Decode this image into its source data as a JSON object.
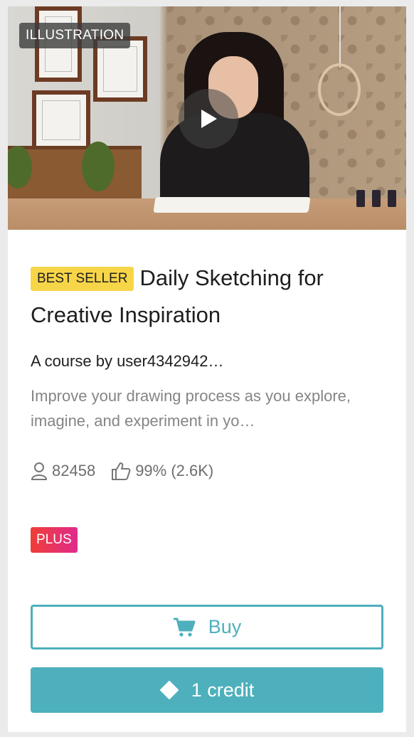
{
  "course": {
    "category_tag": "ILLUSTRATION",
    "badge": "BEST SELLER",
    "title": "Daily Sketching for Creative Inspiration",
    "author": "A course by user4342942…",
    "description": "Improve your drawing process as you explore, imagine, and experiment in yo…",
    "students": "82458",
    "rating": "99% (2.6K)",
    "plan_badge": "PLUS"
  },
  "actions": {
    "buy_label": "Buy",
    "credit_label": "1 credit"
  },
  "colors": {
    "accent": "#4eb0bc",
    "best_seller_bg": "#f7d548",
    "plus_gradient_start": "#ef3e36",
    "plus_gradient_end": "#e02b8d"
  },
  "icons": [
    "play-icon",
    "user-icon",
    "thumbs-up-icon",
    "cart-icon",
    "diamond-icon"
  ]
}
